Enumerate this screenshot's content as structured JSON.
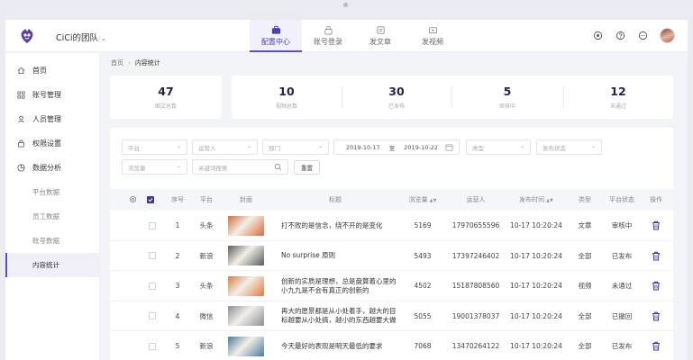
{
  "app": {
    "team_name": "CiCi的团队",
    "nav": [
      {
        "label": "配置中心",
        "icon": "briefcase-icon",
        "active": true
      },
      {
        "label": "账号登录",
        "icon": "lock-icon",
        "active": false
      },
      {
        "label": "发文章",
        "icon": "article-icon",
        "active": false
      },
      {
        "label": "发视频",
        "icon": "video-icon",
        "active": false
      }
    ],
    "header_icons": [
      "settings-icon",
      "help-icon",
      "more-icon"
    ]
  },
  "sidebar": {
    "items": [
      {
        "label": "首页",
        "icon": "home-icon"
      },
      {
        "label": "账号管理",
        "icon": "grid-icon"
      },
      {
        "label": "人员管理",
        "icon": "user-icon"
      },
      {
        "label": "权限设置",
        "icon": "lock-icon"
      },
      {
        "label": "数据分析",
        "icon": "chart-icon"
      }
    ],
    "sub_items": [
      {
        "label": "平台数据",
        "active": false
      },
      {
        "label": "员工数据",
        "active": false
      },
      {
        "label": "账号数据",
        "active": false
      },
      {
        "label": "内容统计",
        "active": true
      }
    ]
  },
  "breadcrumb": {
    "home": "首页",
    "current": "内容统计"
  },
  "stats": {
    "total": {
      "value": "47",
      "label": "图文总数"
    },
    "video": {
      "value": "10",
      "label": "视频总数"
    },
    "published": {
      "value": "30",
      "label": "已发布"
    },
    "reviewing": {
      "value": "5",
      "label": "审核中"
    },
    "rejected": {
      "value": "12",
      "label": "未通过"
    }
  },
  "filters": {
    "platform": "平台",
    "operator": "运营人",
    "department": "部门",
    "date_start": "2019-10-17",
    "date_sep": "至",
    "date_end": "2019-10-22",
    "type": "类型",
    "publish_status": "发布状态",
    "views": "浏览量",
    "keyword_placeholder": "关键词搜索",
    "reset": "重置"
  },
  "table": {
    "columns": {
      "index": "序号",
      "platform": "平台",
      "cover": "封面",
      "title": "标题",
      "views": "浏览量",
      "operator": "运营人",
      "time": "发布时间",
      "type": "类型",
      "status": "平台状态",
      "actions": "操作"
    },
    "rows": [
      {
        "index": "1",
        "platform": "头条",
        "title": "打不败的是信念，绕不开的是变化",
        "views": "5169",
        "operator": "17970655596",
        "time": "10-17 10:20:24",
        "type": "文章",
        "status": "审核中",
        "cover_color": "#d86a3a"
      },
      {
        "index": "2",
        "platform": "新浪",
        "title": "No surprise 原则",
        "views": "5493",
        "operator": "17397246402",
        "time": "10-17 10:20:24",
        "type": "全部",
        "status": "已发布",
        "cover_color": "#5a5a5a"
      },
      {
        "index": "3",
        "platform": "头条",
        "title": "创新的实质是理想，总是盘算着心里的小九九是不会有真正的创新的",
        "views": "4502",
        "operator": "15187808560",
        "time": "10-17 10:20:24",
        "type": "视频",
        "status": "未通过",
        "cover_color": "#e07b3b"
      },
      {
        "index": "4",
        "platform": "微信",
        "title": "再大的愿景都是从小处着手，越大的目标越要从小处搞，越小的东西越要大做",
        "views": "5055",
        "operator": "19001378037",
        "time": "10-17 10:20:24",
        "type": "全部",
        "status": "已撤回",
        "cover_color": "#8a8f95"
      },
      {
        "index": "5",
        "platform": "新浪",
        "title": "今天最好的表现是明天最低的要求",
        "views": "7068",
        "operator": "13470264122",
        "time": "10-17 10:20:24",
        "type": "全部",
        "status": "已发布",
        "cover_color": "#4a7a9a"
      }
    ]
  }
}
